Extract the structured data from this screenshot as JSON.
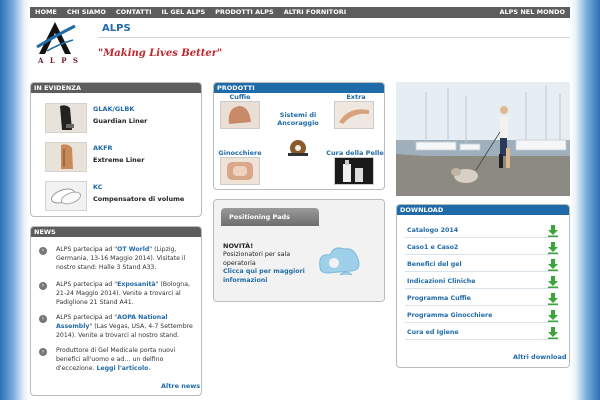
{
  "nav": {
    "left": [
      "HOME",
      "CHI SIAMO",
      "CONTATTI",
      "IL GEL ALPS",
      "PRODOTTI ALPS",
      "ALTRI FORNITORI"
    ],
    "right": "ALPS NEL MONDO"
  },
  "header": {
    "logo_text": "A L P S",
    "brand": "ALPS",
    "slogan": "\"Making Lives Better\""
  },
  "evidenza": {
    "title": "IN EVIDENZA",
    "items": [
      {
        "name": "GLAK/GLBK",
        "desc": "Guardian Liner"
      },
      {
        "name": "AKFR",
        "desc": "Extreme Liner"
      },
      {
        "name": "KC",
        "desc": "Compensatore di volume"
      }
    ]
  },
  "news": {
    "title": "NEWS",
    "items": [
      {
        "pre": "ALPS partecipa ad \"",
        "link": "OT World",
        "post": "\" (Lipzig, Germania, 13-16 Maggio 2014). Visitate il nostro stand: Halle 3 Stand A33."
      },
      {
        "pre": "ALPS partecipa ad \"",
        "link": "Exposanità",
        "post": "\" (Bologna, 21-24 Maggio 2014). Venite a trovarci al Padiglione 21 Stand A41."
      },
      {
        "pre": "ALPS partecipa ad \"",
        "link": "AOPA National Assembly",
        "post": "\" (Las Vegas, USA, 4-7 Settembre 2014). Venite a trovarci al nostro stand."
      },
      {
        "pre": "Produttore di Gel Medicale porta nuovi benefici all'uomo e ad… un delfino d'eccezione. ",
        "link": "Leggi l'articolo",
        "post": "."
      }
    ],
    "more": "Altre news"
  },
  "prodotti": {
    "title": "PRODOTTI",
    "items": [
      "Cuffie",
      "Sistemi di Ancoraggio",
      "Extra",
      "Ginocchiere",
      "Cura della Pelle"
    ]
  },
  "pads": {
    "tab": "Positioning Pads",
    "title": "NOVITÀ!",
    "text": "Posizionatori per sala operatoria",
    "link": "Clicca qui per maggiori informazioni"
  },
  "download": {
    "title": "DOWNLOAD",
    "items": [
      "Catalogo 2014",
      "Caso1 e Caso2",
      "Benefici del gel",
      "Indicazioni Cliniche",
      "Programma Cuffie",
      "Programma Ginocchiere",
      "Cura ed Igiene"
    ],
    "more": "Altri download"
  },
  "colors": {
    "accent": "#1f6aa8",
    "slogan": "#c0262b",
    "nav": "#5d5d5d",
    "download_arrow": "#3aa53a"
  }
}
